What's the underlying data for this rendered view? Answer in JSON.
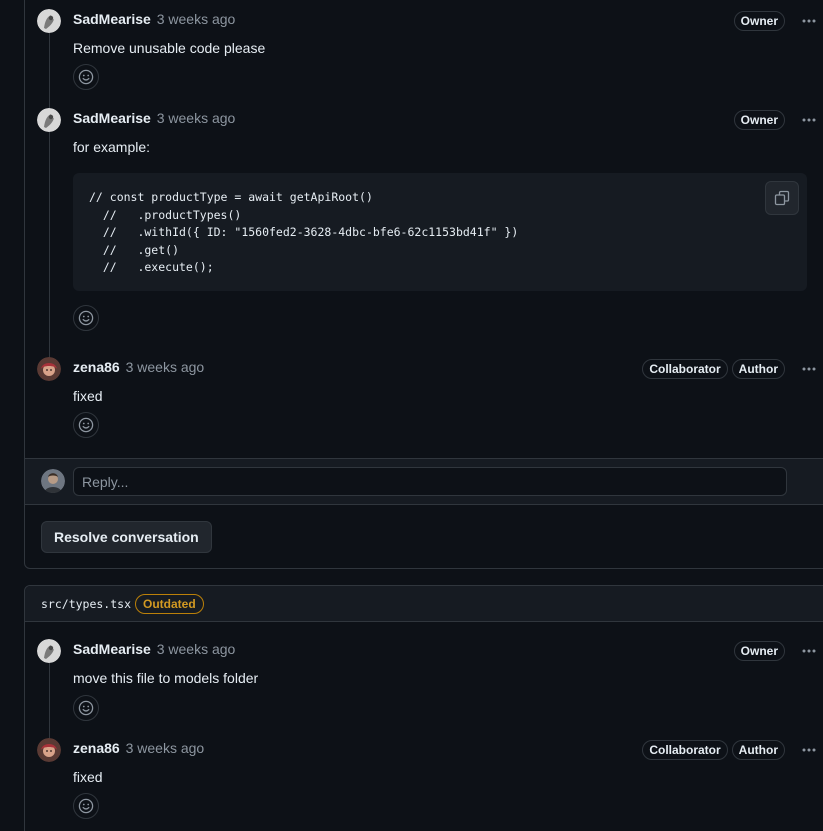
{
  "thread1": {
    "comments": [
      {
        "author": "SadMearise",
        "time": "3 weeks ago",
        "badges": [
          "Owner"
        ],
        "body": "Remove unusable code please",
        "avatar": "sadmearise-avatar"
      },
      {
        "author": "SadMearise",
        "time": "3 weeks ago",
        "badges": [
          "Owner"
        ],
        "body": "for example:",
        "avatar": "sadmearise-avatar",
        "code": [
          "// const productType = await getApiRoot()",
          "  //   .productTypes()",
          "  //   .withId({ ID: \"1560fed2-3628-4dbc-bfe6-62c1153bd41f\" })",
          "  //   .get()",
          "  //   .execute();"
        ]
      },
      {
        "author": "zena86",
        "time": "3 weeks ago",
        "badges": [
          "Collaborator",
          "Author"
        ],
        "body": "fixed",
        "avatar": "zena86-avatar"
      }
    ],
    "reply_placeholder": "Reply...",
    "resolve_label": "Resolve conversation"
  },
  "thread2": {
    "file_path": "src/types.tsx",
    "file_status": "Outdated",
    "comments": [
      {
        "author": "SadMearise",
        "time": "3 weeks ago",
        "badges": [
          "Owner"
        ],
        "body": "move this file to models folder",
        "avatar": "sadmearise-avatar"
      },
      {
        "author": "zena86",
        "time": "3 weeks ago",
        "badges": [
          "Collaborator",
          "Author"
        ],
        "body": "fixed",
        "avatar": "zena86-avatar"
      }
    ]
  },
  "icons": {
    "reaction": "smiley-icon",
    "menu": "kebab-horizontal-icon",
    "copy": "copy-icon"
  },
  "colors": {
    "background": "#0d1117",
    "border": "#30363d",
    "muted_text": "#8d96a0",
    "outdated_accent": "#d29922"
  }
}
